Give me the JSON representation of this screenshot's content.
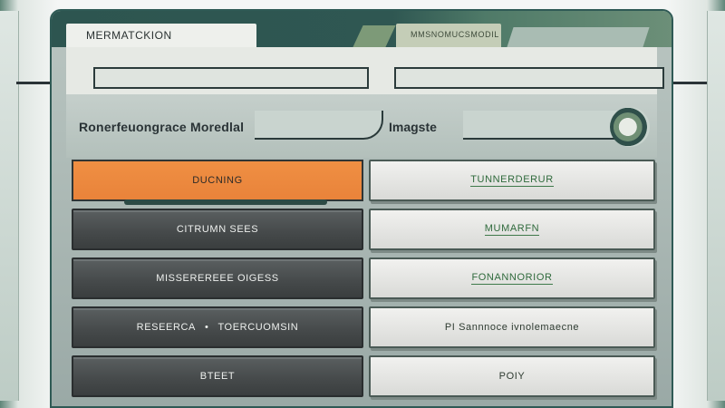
{
  "tabs": {
    "left_label": "MERMATCKION",
    "right_label": "MMSNOMUCSMODIL"
  },
  "inputs": {
    "left_value": "",
    "right_value": ""
  },
  "sections": {
    "left_title": "Ronerfeuongrace Moredlal",
    "right_title": "Imagste"
  },
  "left_buttons": [
    {
      "label": "DUCNING",
      "style": "orange"
    },
    {
      "label": "CITRUMN SEES",
      "style": "dark"
    },
    {
      "label": "MISSEREREEE OIGESS",
      "style": "dark"
    },
    {
      "label": "RESEERCA",
      "label2": "TOERCUOMSIN",
      "style": "dark"
    },
    {
      "label": "BTEET",
      "style": "dark"
    }
  ],
  "right_buttons": [
    {
      "label": "TUNNERDERUR",
      "style": "green"
    },
    {
      "label": "MUMARFN",
      "style": "green"
    },
    {
      "label": "FONANNORIOR",
      "style": "green"
    },
    {
      "label": "PI Sannnoce ivnolemaecne",
      "style": "plain"
    },
    {
      "label": "POIY",
      "style": "plain"
    }
  ],
  "colors": {
    "accent_orange": "#e9833a",
    "frame_teal": "#2d5550",
    "button_dark": "#45494a",
    "text_green": "#2f6a3c"
  }
}
